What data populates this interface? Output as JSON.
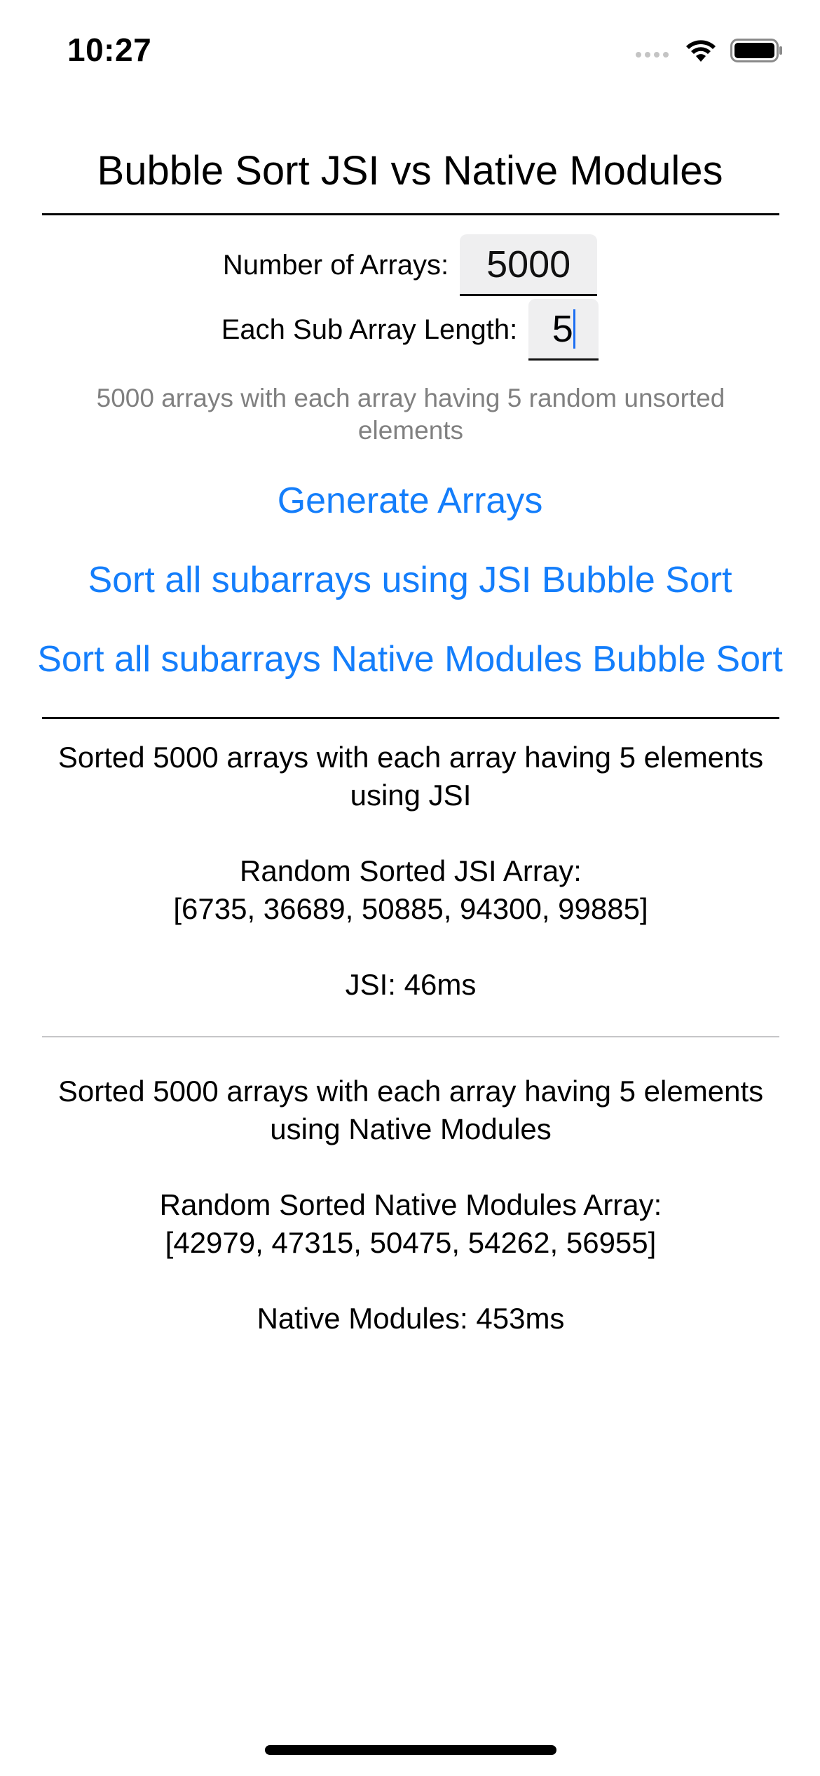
{
  "status_bar": {
    "time": "10:27",
    "icons": [
      "signal-icon",
      "wifi-icon",
      "battery-icon"
    ]
  },
  "title": "Bubble Sort JSI vs Native Modules",
  "inputs": {
    "num_arrays_label": "Number of Arrays:",
    "num_arrays_value": "5000",
    "sub_length_label": "Each Sub Array Length:",
    "sub_length_value": "5"
  },
  "hint": "5000 arrays with each array having 5 random unsorted elements",
  "buttons": {
    "generate": "Generate Arrays",
    "sort_jsi": "Sort all subarrays using JSI Bubble Sort",
    "sort_native": "Sort all subarrays Native Modules Bubble Sort"
  },
  "results": {
    "jsi": {
      "summary": "Sorted 5000 arrays with each array having 5 elements using JSI",
      "array_label": "Random Sorted JSI Array:",
      "array_values": "[6735, 36689, 50885, 94300, 99885]",
      "timing": "JSI: 46ms"
    },
    "native": {
      "summary": "Sorted 5000 arrays with each array having 5 elements using Native Modules",
      "array_label": "Random Sorted Native Modules Array:",
      "array_values": "[42979, 47315, 50475, 54262, 56955]",
      "timing": "Native Modules: 453ms"
    }
  },
  "colors": {
    "link": "#147efb",
    "hint": "#808080",
    "caret": "#1c6ef2"
  }
}
